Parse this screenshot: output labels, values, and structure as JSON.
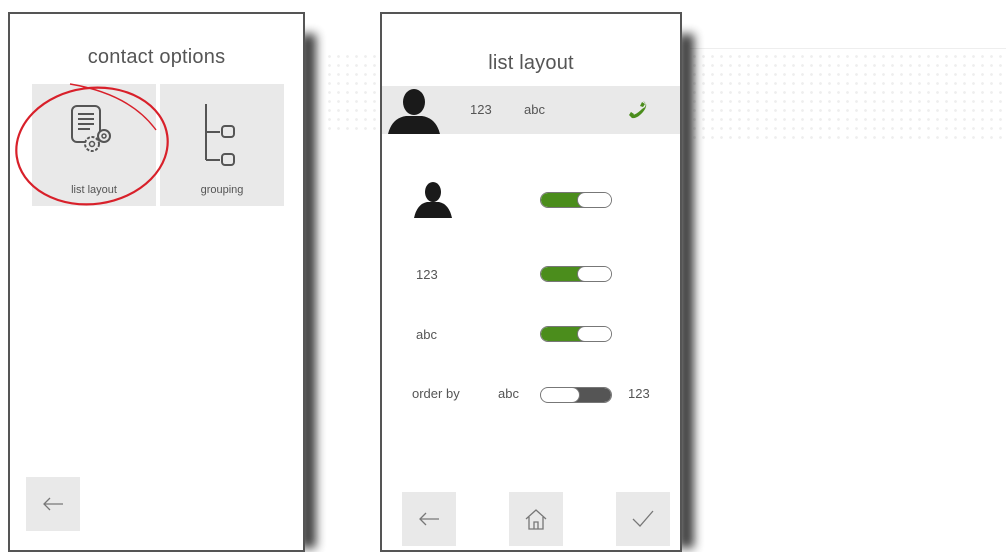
{
  "screen1": {
    "title": "contact options",
    "tiles": [
      {
        "label": "list layout",
        "icon": "document-gears-icon"
      },
      {
        "label": "grouping",
        "icon": "tree-grouping-icon"
      }
    ],
    "back_icon": "arrow-left-icon"
  },
  "screen2": {
    "title": "list layout",
    "preview": {
      "number": "123",
      "name": "abc",
      "avatar_icon": "person-silhouette-icon",
      "call_icon": "phone-icon"
    },
    "options": [
      {
        "icon": "person-silhouette-icon",
        "state": "on"
      },
      {
        "label": "123",
        "state": "on"
      },
      {
        "label": "abc",
        "state": "on"
      }
    ],
    "order": {
      "label": "order by",
      "left": "abc",
      "right": "123",
      "selected": "123"
    },
    "nav": {
      "back_icon": "arrow-left-icon",
      "home_icon": "home-icon",
      "confirm_icon": "checkmark-icon"
    }
  },
  "colors": {
    "accent_green": "#4b8d1c",
    "frame": "#555555",
    "tile_bg": "#e9e9e9",
    "annotation_red": "#d8202a"
  }
}
